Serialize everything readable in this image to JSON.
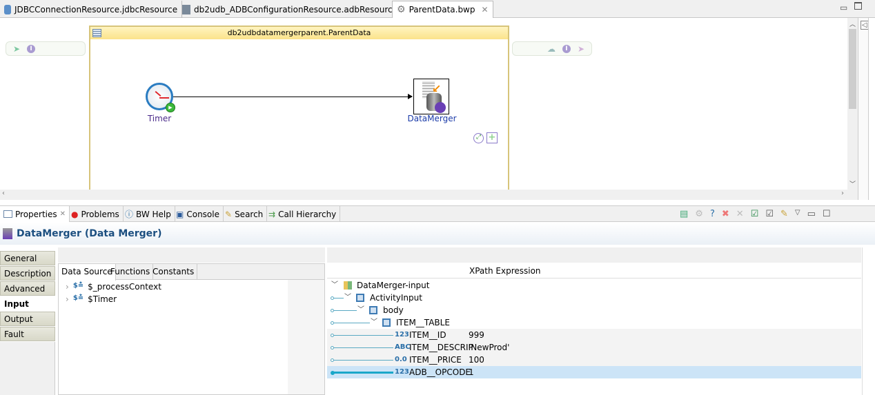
{
  "editor_tabs": [
    {
      "label": "JDBCConnectionResource.jdbcResource",
      "icon": "database-icon"
    },
    {
      "label": "db2udb_ADBConfigurationResource.adbResource",
      "icon": "adb-resource-icon"
    },
    {
      "label": "ParentData.bwp",
      "icon": "gear-icon",
      "active": true
    }
  ],
  "canvas": {
    "group_title": "db2udbdatamergerparent.ParentData",
    "activities": [
      {
        "label": "Timer",
        "icon": "timer-clock-icon"
      },
      {
        "label": "DataMerger",
        "icon": "data-merger-icon"
      }
    ]
  },
  "panel_tabs": [
    {
      "label": "Properties",
      "active": true
    },
    {
      "label": "Problems"
    },
    {
      "label": "BW Help"
    },
    {
      "label": "Console"
    },
    {
      "label": "Search"
    },
    {
      "label": "Call Hierarchy"
    }
  ],
  "properties": {
    "title": "DataMerger (Data Merger)",
    "side_tabs": [
      "General",
      "Description",
      "Advanced",
      "Input",
      "Output",
      "Fault"
    ],
    "active_side_tab": "Input",
    "source_tabs": [
      "Data Source",
      "Functions",
      "Constants"
    ],
    "sources": [
      "$_processContext",
      "$Timer"
    ],
    "xpath_header": "XPath Expression",
    "tree": [
      {
        "name": "DataMerger-input",
        "depth": 0
      },
      {
        "name": "ActivityInput",
        "depth": 1
      },
      {
        "name": "body",
        "depth": 2
      },
      {
        "name": "ITEM__TABLE",
        "depth": 3
      },
      {
        "name": "ITEM__ID",
        "type": "123",
        "value": "999"
      },
      {
        "name": "ITEM__DESCRIP",
        "type": "ABC",
        "value": "'NewProd'"
      },
      {
        "name": "ITEM__PRICE",
        "type": "0.0",
        "value": "100"
      },
      {
        "name": "ADB__OPCODE",
        "type": "123",
        "value": "1",
        "selected": true
      }
    ]
  },
  "colors": {
    "accent": "#1c4f80",
    "selection": "#cce4f7",
    "mapping_line": "#59a9c2"
  }
}
